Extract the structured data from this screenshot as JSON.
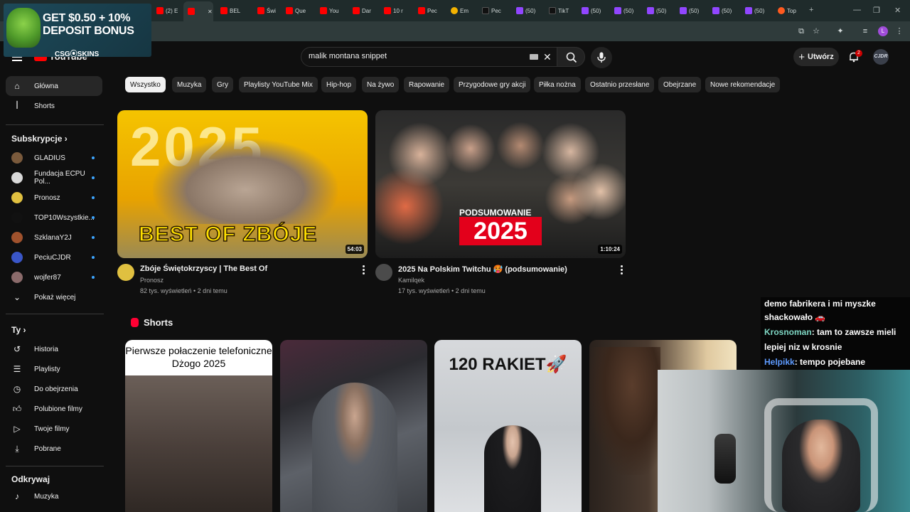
{
  "browser": {
    "tabs": [
      {
        "label": "(2) E",
        "icon": "youtube-icon"
      },
      {
        "label": "",
        "icon": "youtube-icon"
      },
      {
        "label": "BEL",
        "icon": "youtube-icon"
      },
      {
        "label": "Świ",
        "icon": "youtube-icon"
      },
      {
        "label": "Que",
        "icon": "youtube-icon"
      },
      {
        "label": "You",
        "icon": "youtube-icon"
      },
      {
        "label": "Dar",
        "icon": "youtube-icon"
      },
      {
        "label": "10 r",
        "icon": "youtube-icon"
      },
      {
        "label": "Pec",
        "icon": "youtube-icon"
      },
      {
        "label": "Em",
        "icon": "emoji-icon"
      },
      {
        "label": "Pec",
        "icon": "tiktok-icon"
      },
      {
        "label": "(50)",
        "icon": "twitch-icon"
      },
      {
        "label": "TikT",
        "icon": "tiktok-icon"
      },
      {
        "label": "(50)",
        "icon": "twitch-icon"
      },
      {
        "label": "(50)",
        "icon": "twitch-icon"
      },
      {
        "label": "(50)",
        "icon": "twitch-icon"
      },
      {
        "label": "(50)",
        "icon": "twitch-icon"
      },
      {
        "label": "(50)",
        "icon": "twitch-icon"
      },
      {
        "label": "(50)",
        "icon": "twitch-icon"
      },
      {
        "label": "Top",
        "icon": "firefox-icon"
      }
    ],
    "profile_initial": "L"
  },
  "ad": {
    "line1": "GET $0.50 + 10%",
    "line2": "DEPOSIT BONUS",
    "brand": "CSG⦿SKINS"
  },
  "header": {
    "logo_text": "YouTube",
    "search_value": "malik montana snippet",
    "create_label": "Utwórz",
    "notification_count": "2",
    "avatar_text": "CJDR"
  },
  "sidebar": {
    "main": [
      {
        "label": "Główna",
        "icon": "home-icon"
      },
      {
        "label": "Shorts",
        "icon": "shorts-icon"
      }
    ],
    "subscriptions_heading": "Subskrypcje",
    "subscriptions": [
      {
        "label": "GLADIUS",
        "color": "#7a5a3c"
      },
      {
        "label": "Fundacja ECPU Pol...",
        "color": "#d9d9d9"
      },
      {
        "label": "Pronosz",
        "color": "#e0c040"
      },
      {
        "label": "TOP10Wszystkie...",
        "color": "#111111"
      },
      {
        "label": "SzklanaY2J",
        "color": "#a0522d"
      },
      {
        "label": "PeciuCJDR",
        "color": "#3a56c8"
      },
      {
        "label": "wojfer87",
        "color": "#8b6b6b"
      }
    ],
    "show_more": "Pokaż więcej",
    "you_heading": "Ty",
    "you_items": [
      {
        "label": "Historia",
        "icon": "history-icon"
      },
      {
        "label": "Playlisty",
        "icon": "playlist-icon"
      },
      {
        "label": "Do obejrzenia",
        "icon": "clock-icon"
      },
      {
        "label": "Polubione filmy",
        "icon": "thumbs-up-icon"
      },
      {
        "label": "Twoje filmy",
        "icon": "video-icon"
      },
      {
        "label": "Pobrane",
        "icon": "download-icon"
      }
    ],
    "explore_heading": "Odkrywaj",
    "explore_items": [
      {
        "label": "Muzyka",
        "icon": "music-icon"
      }
    ]
  },
  "chips": [
    "Wszystko",
    "Muzyka",
    "Gry",
    "Playlisty YouTube Mix",
    "Hip-hop",
    "Na żywo",
    "Rapowanie",
    "Przygodowe gry akcji",
    "Piłka nożna",
    "Ostatnio przesłane",
    "Obejrzane",
    "Nowe rekomendacje"
  ],
  "videos": [
    {
      "title": "Zbóje Świętokrzyscy | The Best Of",
      "channel": "Pronosz",
      "meta": "82 tys. wyświetleń • 2 dni temu",
      "duration": "54:03",
      "thumb_text": "BEST OF ZBÓJE",
      "thumb_year": "2025"
    },
    {
      "title": "2025 Na Polskim Twitchu 🥵 (podsumowanie)",
      "channel": "Kamilqek",
      "meta": "17 tys. wyświetleń • 2 dni temu",
      "duration": "1:10:24",
      "thumb_text": "PODSUMOWANIE",
      "thumb_year": "2025"
    }
  ],
  "shorts": {
    "heading": "Shorts",
    "items": [
      {
        "caption": "Pierwsze połaczenie telefoniczne Dżogo 2025"
      },
      {
        "caption": ""
      },
      {
        "caption": "120 RAKIET🚀"
      },
      {
        "caption": ""
      }
    ]
  },
  "chat": [
    {
      "user": "",
      "text": "demo fabrikera i mi myszke"
    },
    {
      "user": "",
      "text": "shackowało 🚗"
    },
    {
      "user": "Krosnoman",
      "text": ": tam to zawsze mieli"
    },
    {
      "user": "",
      "text": "lepiej niz w krosnie"
    },
    {
      "user": "Helpikk",
      "text": ": tempo pojebane"
    }
  ]
}
